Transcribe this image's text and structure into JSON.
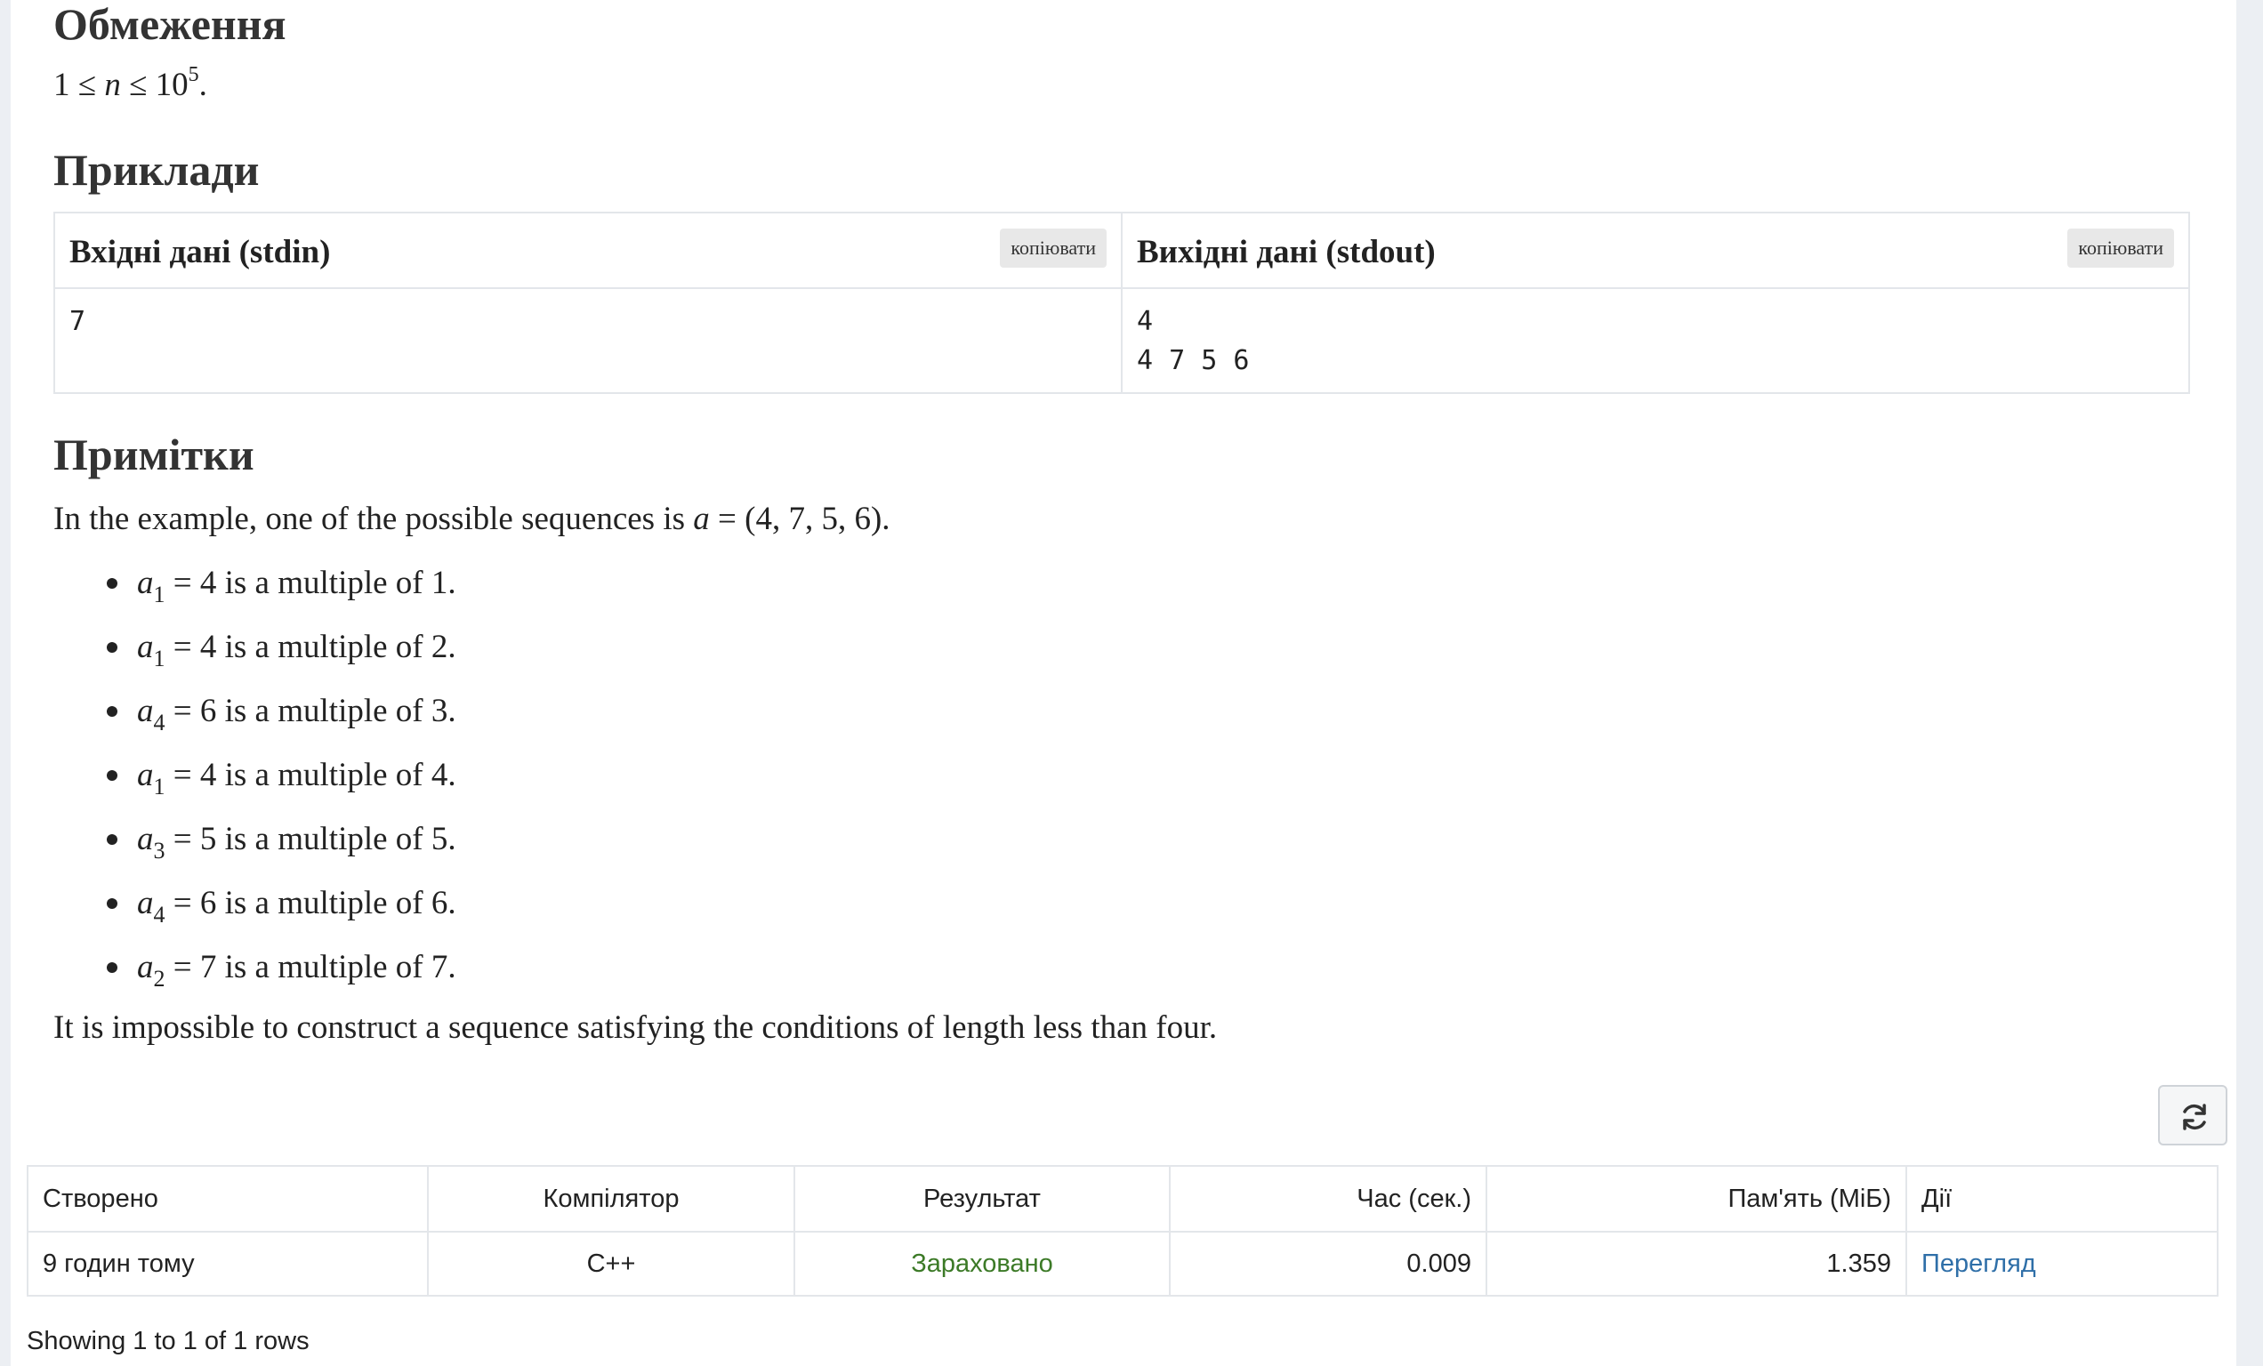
{
  "constraints": {
    "heading": "Обмеження",
    "expr": {
      "lhs": "1",
      "le1": "≤",
      "var": "n",
      "le2": "≤",
      "base": "10",
      "exp": "5",
      "end": "."
    }
  },
  "examples": {
    "heading": "Приклади",
    "input_title": "Вхідні дані (stdin)",
    "output_title": "Вихідні дані (stdout)",
    "copy_label": "копіювати",
    "input_text": "7",
    "output_text": "4\n4 7 5 6"
  },
  "notes": {
    "heading": "Примітки",
    "intro_text": "In the example, one of the possible sequences is",
    "intro_var": "a",
    "intro_tail": " = (4, 7, 5, 6).",
    "items": [
      {
        "var": "a",
        "sub": "1",
        "val": "4",
        "k": "1"
      },
      {
        "var": "a",
        "sub": "1",
        "val": "4",
        "k": "2"
      },
      {
        "var": "a",
        "sub": "4",
        "val": "6",
        "k": "3"
      },
      {
        "var": "a",
        "sub": "1",
        "val": "4",
        "k": "4"
      },
      {
        "var": "a",
        "sub": "3",
        "val": "5",
        "k": "5"
      },
      {
        "var": "a",
        "sub": "4",
        "val": "6",
        "k": "6"
      },
      {
        "var": "a",
        "sub": "2",
        "val": "7",
        "k": "7"
      }
    ],
    "mult_text": " is a multiple of ",
    "conclusion": "It is impossible to construct a sequence satisfying the conditions of length less than four."
  },
  "submissions": {
    "refresh_icon": "refresh-icon",
    "headers": [
      "Створено",
      "Компілятор",
      "Результат",
      "Час (сек.)",
      "Пам'ять (МіБ)",
      "Дії"
    ],
    "rows": [
      {
        "created": "9 годин тому",
        "compiler": "C++",
        "result": "Зараховано",
        "time": "0.009",
        "memory": "1.359",
        "action": "Перегляд"
      }
    ],
    "showing": "Showing 1 to 1 of 1 rows",
    "colors": {
      "accepted": "#3c7a27",
      "link": "#2f6fa8"
    }
  }
}
